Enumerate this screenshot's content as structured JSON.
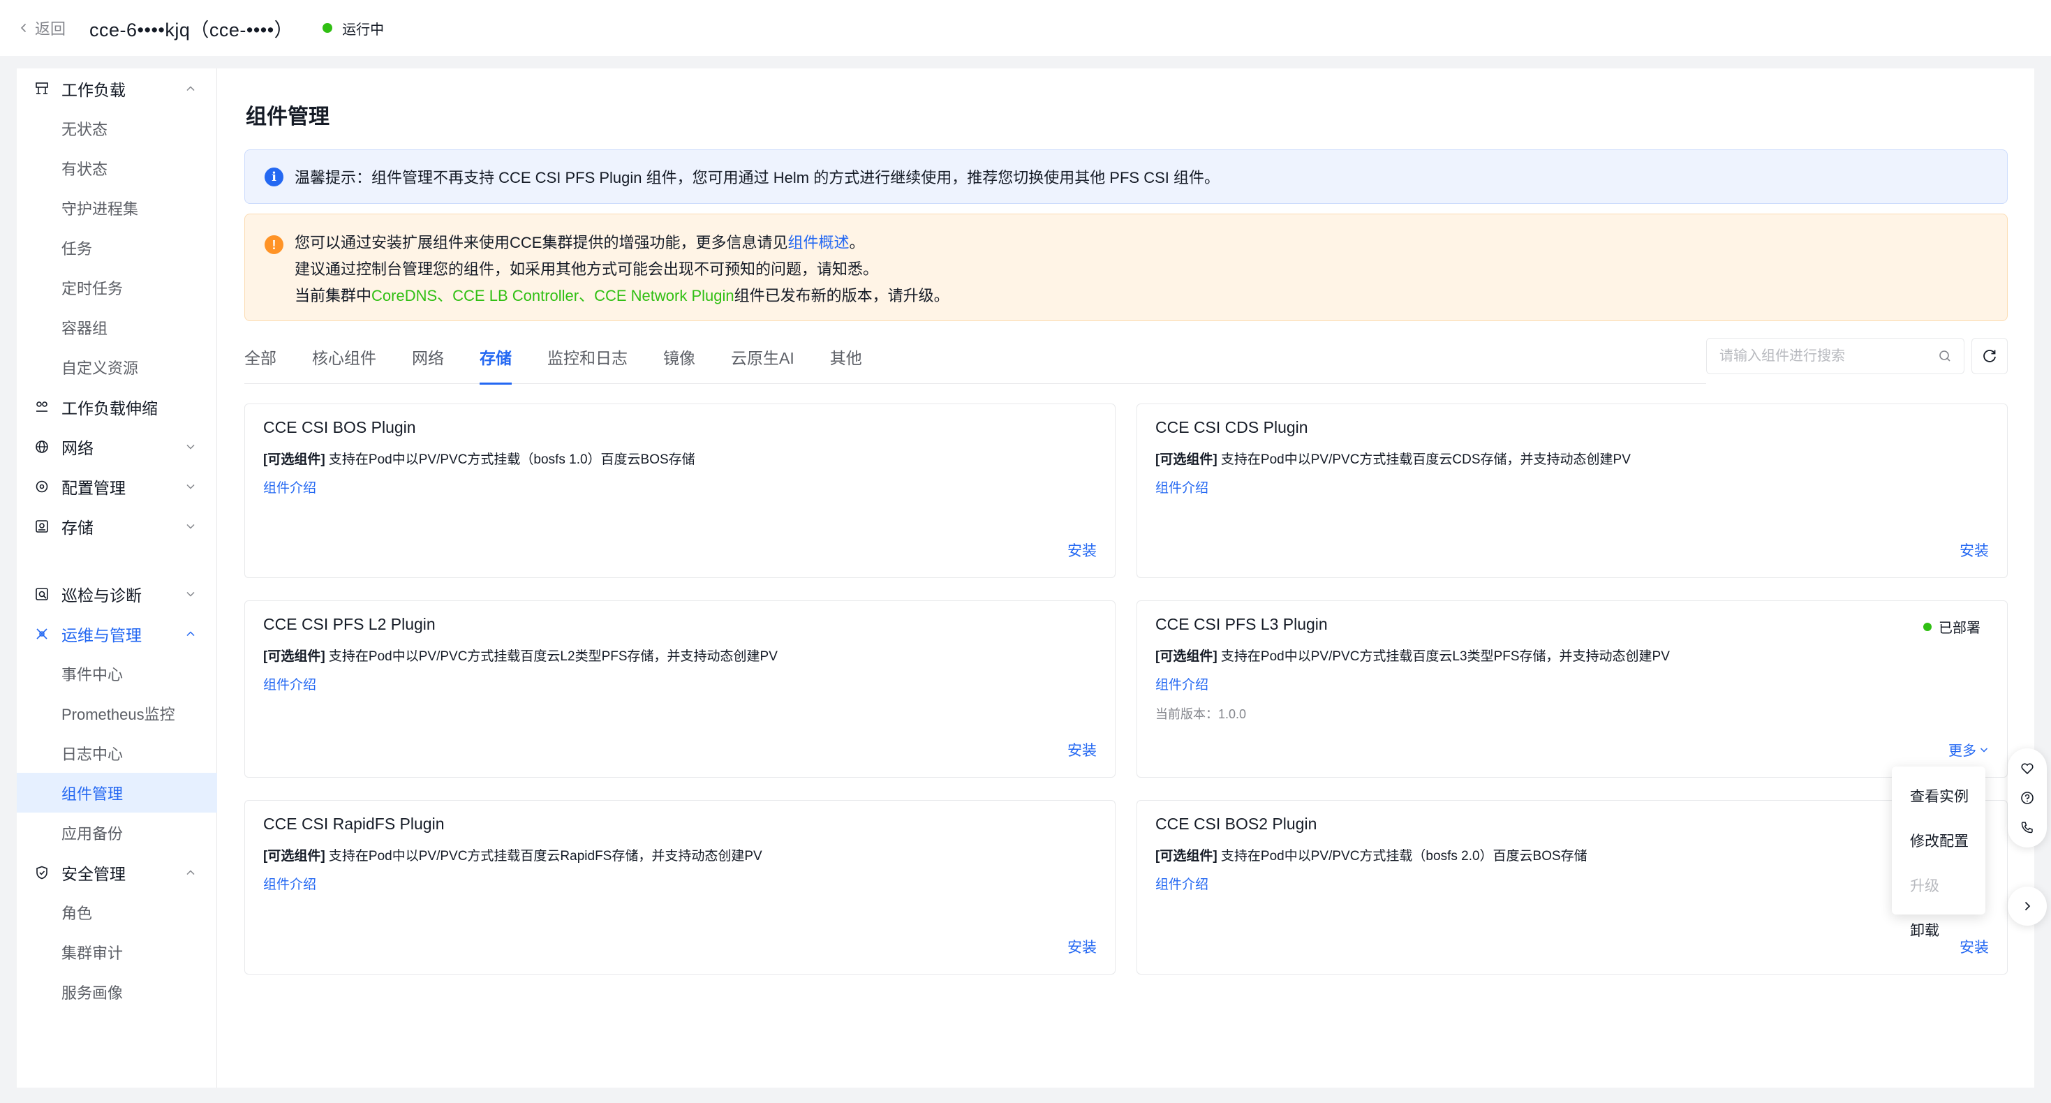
{
  "header": {
    "back_label": "返回",
    "cluster_title": "cce-6••••kjq（cce-••••）",
    "status": "运行中",
    "status_color": "#30bf13"
  },
  "sidebar": {
    "workload": {
      "label": "工作负载",
      "items": [
        "无状态",
        "有状态",
        "守护进程集",
        "任务",
        "定时任务",
        "容器组",
        "自定义资源"
      ]
    },
    "scaling": {
      "label": "工作负载伸缩"
    },
    "network": {
      "label": "网络"
    },
    "config": {
      "label": "配置管理"
    },
    "storage": {
      "label": "存储"
    },
    "inspection": {
      "label": "巡检与诊断"
    },
    "ops": {
      "label": "运维与管理",
      "items": [
        "事件中心",
        "Prometheus监控",
        "日志中心",
        "组件管理",
        "应用备份"
      ],
      "selected": "组件管理"
    },
    "security": {
      "label": "安全管理",
      "items": [
        "角色",
        "集群审计",
        "服务画像"
      ]
    }
  },
  "main": {
    "title": "组件管理",
    "info_alert": "温馨提示：组件管理不再支持 CCE CSI PFS Plugin 组件，您可用通过 Helm 的方式进行继续使用，推荐您切换使用其他 PFS CSI 组件。",
    "warn_alert": {
      "line1_prefix": "您可以通过安装扩展组件来使用CCE集群提供的增强功能，更多信息请见",
      "line1_link": "组件概述",
      "line1_suffix": "。",
      "line2": "建议通过控制台管理您的组件，如采用其他方式可能会出现不可预知的问题，请知悉。",
      "line3_prefix": "当前集群中",
      "line3_highlight": "CoreDNS、CCE LB Controller、CCE Network Plugin",
      "line3_suffix": "组件已发布新的版本，请升级。"
    },
    "tabs": [
      "全部",
      "核心组件",
      "网络",
      "存储",
      "监控和日志",
      "镜像",
      "云原生AI",
      "其他"
    ],
    "active_tab": "存储",
    "search_placeholder": "请输入组件进行搜索",
    "cards": [
      {
        "title": "CCE CSI BOS Plugin",
        "tag": "[可选组件]",
        "desc": " 支持在Pod中以PV/PVC方式挂载（bosfs 1.0）百度云BOS存储",
        "intro": "组件介绍",
        "action": "安装"
      },
      {
        "title": "CCE CSI CDS Plugin",
        "tag": "[可选组件]",
        "desc": " 支持在Pod中以PV/PVC方式挂载百度云CDS存储，并支持动态创建PV",
        "intro": "组件介绍",
        "action": "安装"
      },
      {
        "title": "CCE CSI PFS L2 Plugin",
        "tag": "[可选组件]",
        "desc": " 支持在Pod中以PV/PVC方式挂载百度云L2类型PFS存储，并支持动态创建PV",
        "intro": "组件介绍",
        "action": "安装"
      },
      {
        "title": "CCE CSI PFS L3 Plugin",
        "tag": "[可选组件]",
        "desc": " 支持在Pod中以PV/PVC方式挂载百度云L3类型PFS存储，并支持动态创建PV",
        "intro": "组件介绍",
        "status": "已部署",
        "version": "当前版本：1.0.0",
        "more": "更多"
      },
      {
        "title": "CCE CSI RapidFS Plugin",
        "tag": "[可选组件]",
        "desc": " 支持在Pod中以PV/PVC方式挂载百度云RapidFS存储，并支持动态创建PV",
        "intro": "组件介绍",
        "action": "安装"
      },
      {
        "title": "CCE CSI BOS2 Plugin",
        "tag": "[可选组件]",
        "desc": " 支持在Pod中以PV/PVC方式挂载（bosfs 2.0）百度云BOS存储",
        "intro": "组件介绍",
        "action": "安装"
      }
    ],
    "dropdown": [
      "查看实例",
      "修改配置",
      "升级",
      "卸载"
    ]
  },
  "colors": {
    "primary": "#2468f2",
    "success": "#30bf13",
    "warning": "#ff9326"
  }
}
